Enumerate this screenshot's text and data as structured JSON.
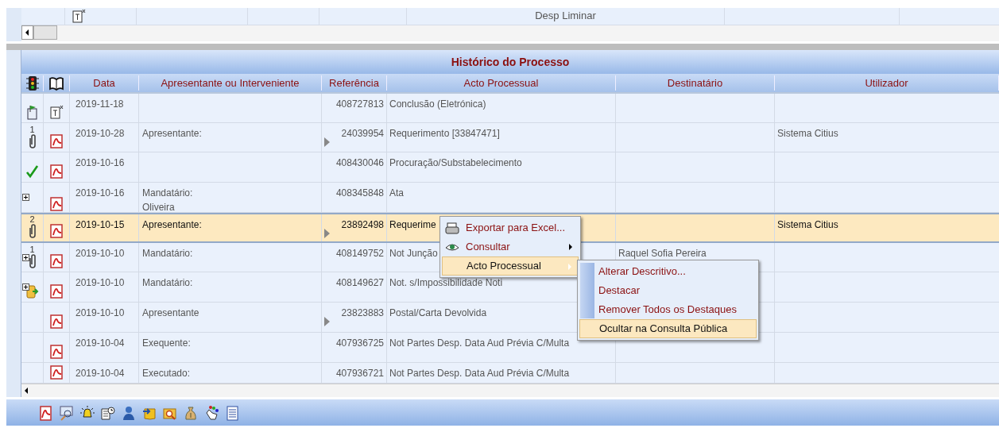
{
  "upper_grid": {
    "row": {
      "act": "Desp Liminar"
    }
  },
  "panel": {
    "title": "Histórico do Processo"
  },
  "table": {
    "columns": [
      "Data",
      "Apresentante ou Interveniente",
      "Referência",
      "Acto Processual",
      "Destinatário",
      "Utilizador"
    ],
    "rows": [
      {
        "selected": false,
        "expandable": false,
        "kind": "flag-doc",
        "attachments": "",
        "pdf": false,
        "date": "2019-11-18",
        "party": "",
        "arrow": false,
        "reference": "408727813",
        "act": "Conclusão (Eletrónica)",
        "recipient": "",
        "user": ""
      },
      {
        "selected": false,
        "expandable": false,
        "kind": "clip",
        "attachments": "1",
        "pdf": true,
        "date": "2019-10-28",
        "party": "Apresentante:",
        "arrow": true,
        "reference": "24039954",
        "act": "Requerimento [33847471]",
        "recipient": "",
        "user": "Sistema Citius"
      },
      {
        "selected": false,
        "expandable": false,
        "kind": "check",
        "attachments": "",
        "pdf": true,
        "date": "2019-10-16",
        "party": "",
        "arrow": false,
        "reference": "408430046",
        "act": "Procuração/Substabelecimento",
        "recipient": "",
        "user": ""
      },
      {
        "selected": false,
        "expandable": true,
        "kind": "plain",
        "attachments": "",
        "pdf": true,
        "date": "2019-10-16",
        "party": "Mandatário:",
        "party_line2": "Oliveira",
        "arrow": false,
        "reference": "408345848",
        "act": "Ata",
        "recipient": "",
        "user": ""
      },
      {
        "selected": true,
        "expandable": false,
        "kind": "clip",
        "attachments": "2",
        "pdf": true,
        "date": "2019-10-15",
        "party": "Apresentante:",
        "arrow": true,
        "reference": "23892498",
        "act": "Requerime",
        "recipient": "",
        "user": "Sistema Citius"
      },
      {
        "selected": false,
        "expandable": true,
        "kind": "clip",
        "attachments": "1",
        "pdf": true,
        "date": "2019-10-10",
        "party": "Mandatário:",
        "arrow": false,
        "reference": "408149752",
        "act": "Not Junção",
        "recipient": "Raquel Sofia Pereira",
        "user": ""
      },
      {
        "selected": false,
        "expandable": true,
        "kind": "folder-arrow",
        "attachments": "",
        "pdf": true,
        "date": "2019-10-10",
        "party": "Mandatário:",
        "arrow": false,
        "reference": "408149627",
        "act": "Not. s/Impossibilidade Noti",
        "recipient": "",
        "user": ""
      },
      {
        "selected": false,
        "expandable": false,
        "kind": "plain",
        "attachments": "",
        "pdf": true,
        "date": "2019-10-10",
        "party": "Apresentante",
        "arrow": true,
        "reference": "23823883",
        "act": "Postal/Carta Devolvida",
        "recipient": "",
        "user": ""
      },
      {
        "selected": false,
        "expandable": false,
        "kind": "plain",
        "attachments": "",
        "pdf": true,
        "date": "2019-10-04",
        "party": "Exequente:",
        "arrow": false,
        "reference": "407936725",
        "act": "Not Partes Desp. Data Aud Prévia C/Multa",
        "recipient": "",
        "user": ""
      },
      {
        "selected": false,
        "expandable": false,
        "kind": "plain",
        "attachments": "",
        "pdf": true,
        "date": "2019-10-04",
        "party": "Executado:",
        "arrow": false,
        "reference": "407936721",
        "act": "Not Partes Desp. Data Aud Prévia C/Multa",
        "recipient": "",
        "user": ""
      }
    ]
  },
  "context_menu": {
    "items": [
      {
        "label": "Exportar para Excel...",
        "submenu": false,
        "selected": false
      },
      {
        "label": "Consultar",
        "submenu": true,
        "selected": false
      },
      {
        "label": "Acto Processual",
        "submenu": true,
        "selected": true
      }
    ],
    "submenu": [
      {
        "label": "Alterar Descritivo...",
        "selected": false
      },
      {
        "label": "Destacar",
        "selected": false
      },
      {
        "label": "Remover Todos os Destaques",
        "selected": false
      },
      {
        "label": "Ocultar na Consulta Pública",
        "selected": true
      }
    ]
  }
}
